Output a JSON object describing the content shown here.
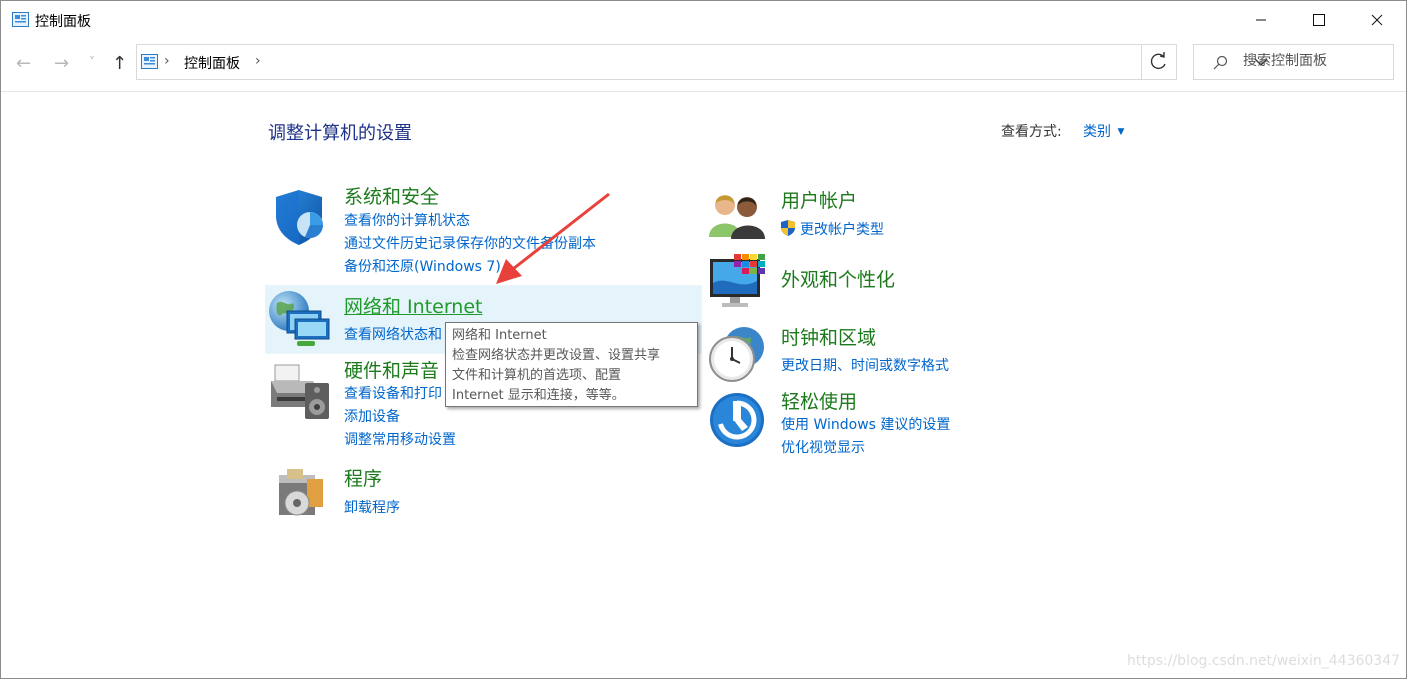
{
  "window": {
    "title": "控制面板",
    "controls": {
      "minimize": "—",
      "maximize": "☐",
      "close": "✕"
    }
  },
  "address_bar": {
    "nav": {
      "back": "←",
      "forward": "→",
      "recent": "˅",
      "up": "↑"
    },
    "breadcrumb": [
      "控制面板"
    ],
    "separator": "›",
    "refresh_icon": "refresh-icon",
    "search_placeholder": "搜索控制面板"
  },
  "main": {
    "page_title": "调整计算机的设置",
    "view_by_label": "查看方式:",
    "view_by_value": "类别",
    "categories_left": [
      {
        "title": "系统和安全",
        "icon": "shield-icon",
        "links": [
          "查看你的计算机状态",
          "通过文件历史记录保存你的文件备份副本",
          "备份和还原(Windows 7)"
        ]
      },
      {
        "title": "网络和 Internet",
        "icon": "network-globe-icon",
        "links": [
          "查看网络状态和"
        ]
      },
      {
        "title": "硬件和声音",
        "icon": "printer-icon",
        "links": [
          "查看设备和打印",
          "添加设备",
          "调整常用移动设置"
        ]
      },
      {
        "title": "程序",
        "icon": "programs-icon",
        "links": [
          "卸载程序"
        ]
      }
    ],
    "categories_right": [
      {
        "title": "用户帐户",
        "icon": "users-icon",
        "links": [
          "更改帐户类型"
        ],
        "link_icon": "uac-shield-icon"
      },
      {
        "title": "外观和个性化",
        "icon": "monitor-colors-icon",
        "links": []
      },
      {
        "title": "时钟和区域",
        "icon": "clock-globe-icon",
        "links": [
          "更改日期、时间或数字格式"
        ]
      },
      {
        "title": "轻松使用",
        "icon": "ease-of-access-icon",
        "links": [
          "使用 Windows 建议的设置",
          "优化视觉显示"
        ]
      }
    ]
  },
  "tooltip": {
    "lines": [
      "网络和 Internet",
      "检查网络状态并更改设置、设置共享",
      "文件和计算机的首选项、配置",
      "Internet 显示和连接，等等。"
    ]
  },
  "watermark": "https://blog.csdn.net/weixin_44360347",
  "colors": {
    "link": "#0066cc",
    "category_title": "#1c7a1c",
    "page_title": "#1e3287",
    "hover_bg": "#e5f3fb",
    "annotation_arrow": "#e8413c"
  }
}
